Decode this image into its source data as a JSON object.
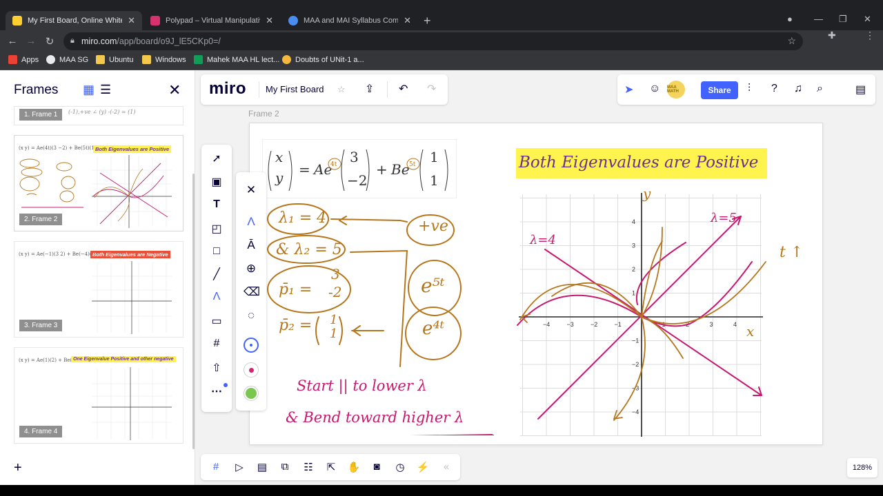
{
  "browser": {
    "tabs": [
      {
        "title": "My First Board, Online Whiteboard",
        "favicon_color": "#ffd02f",
        "active": true
      },
      {
        "title": "Polypad – Virtual Manipulatives",
        "favicon_color": "#d6336c",
        "active": false
      },
      {
        "title": "MAA and MAI Syllabus Combined",
        "favicon_color": "#4a8df0",
        "active": false
      }
    ],
    "url_host": "miro.com",
    "url_path": "/app/board/o9J_lE5CKp0=/",
    "bookmarks": [
      {
        "label": "Apps",
        "icon": "apps-grid-icon",
        "color": "#ea4335"
      },
      {
        "label": "MAA SG",
        "icon": "globe-icon",
        "color": "#e8eaed"
      },
      {
        "label": "Ubuntu",
        "icon": "folder-icon",
        "color": "#f2c94c"
      },
      {
        "label": "Windows",
        "icon": "folder-icon",
        "color": "#f2c94c"
      },
      {
        "label": "Mahek MAA HL lect...",
        "icon": "sheets-icon",
        "color": "#0f9d58"
      },
      {
        "label": "Doubts of UNit-1 a...",
        "icon": "medal-icon",
        "color": "#f6b73c"
      }
    ]
  },
  "miro": {
    "logo": "miro",
    "board_name": "My First Board",
    "share_label": "Share",
    "avatar_text": "MAA MATH",
    "zoom": "128%",
    "accent": "#4262ff",
    "current_frame": "Frame 2"
  },
  "frames_panel": {
    "title": "Frames",
    "frames": [
      {
        "label": "1. Frame 1",
        "thumb_title": ""
      },
      {
        "label": "2. Frame 2",
        "thumb_title": "Both Eigenvalues are Positive",
        "thumb_title_bg": "#fff34d",
        "thumb_title_color": "#6a2f8f"
      },
      {
        "label": "3. Frame 3",
        "thumb_title": "Both Eigenvalues are Negative",
        "thumb_title_bg": "#e8503a",
        "thumb_title_color": "#ffffff"
      },
      {
        "label": "4. Frame 4",
        "thumb_title": "One Eigenvalue Positive and other negative",
        "thumb_title_bg": "#fff34d",
        "thumb_title_color": "#6a2f8f"
      }
    ]
  },
  "board": {
    "banner": "Both Eigenvalues are Positive",
    "equation": {
      "lhs_top": "x",
      "lhs_bottom": "y",
      "a_coeff": "Ae",
      "a_exp": "4t",
      "v1_top": "3",
      "v1_bottom": "−2",
      "plus": "+",
      "b_coeff": "Be",
      "b_exp": "5t",
      "v2_top": "1",
      "v2_bottom": "1"
    },
    "notes": {
      "lambda1": "λ₁ = 4",
      "lambda2": "& λ₂ = 5",
      "plus_ve": "+ve",
      "p1": "p̄₁ =",
      "p1_top": "3",
      "p1_bottom": "-2",
      "p2": "p̄₂ =",
      "p2_top": "1",
      "p2_bottom": "1",
      "e5t": "e⁵ᵗ",
      "e4t": "e⁴ᵗ",
      "start": "Start || to lower λ",
      "bend": "& Bend toward higher λ",
      "lambda4_label": "λ=4",
      "lambda5_label": "λ=5",
      "t_arrow": "t ↑",
      "x_label": "x",
      "y_label": "y"
    },
    "ink_brown": "#b5761b",
    "ink_magenta": "#c8176e",
    "ink_red": "#d6246e"
  },
  "graph": {
    "x_ticks": [
      "−4",
      "−3",
      "−2",
      "−1",
      "1",
      "2",
      "3",
      "4"
    ],
    "y_ticks": [
      "4",
      "3",
      "2",
      "1",
      "−1",
      "−2",
      "−3",
      "−4"
    ]
  }
}
